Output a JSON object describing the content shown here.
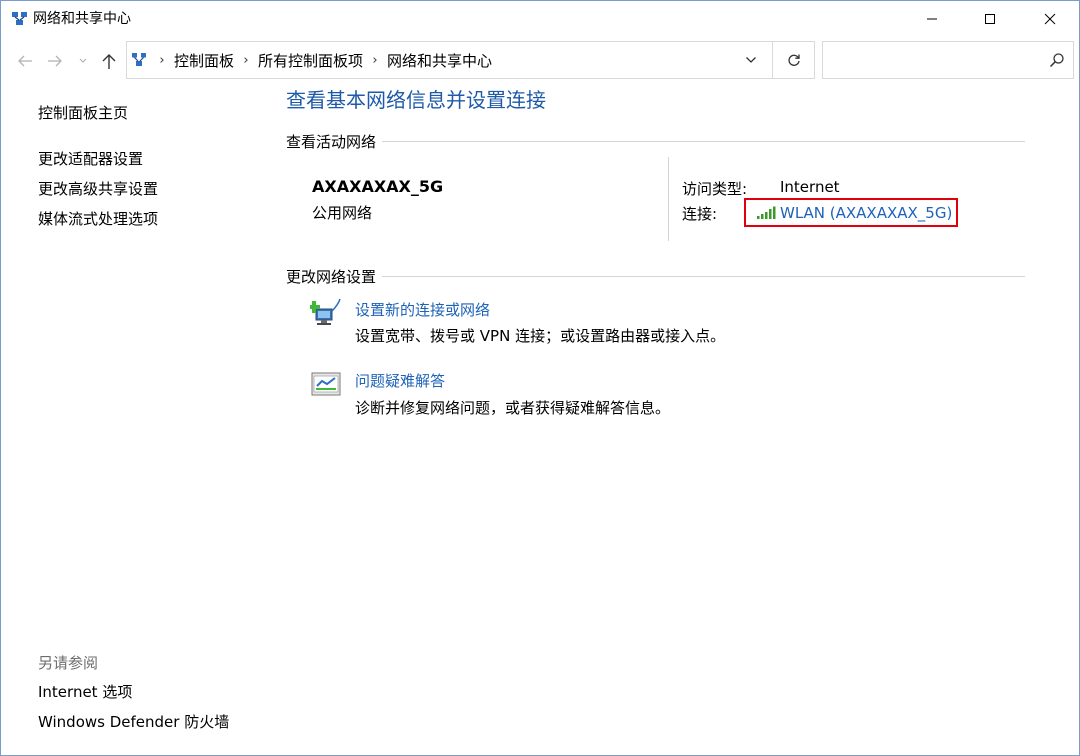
{
  "window": {
    "title": "网络和共享中心"
  },
  "address": {
    "breadcrumbs": [
      "控制面板",
      "所有控制面板项",
      "网络和共享中心"
    ],
    "search_placeholder": ""
  },
  "sidebar": {
    "home": "控制面板主页",
    "links": [
      "更改适配器设置",
      "更改高级共享设置",
      "媒体流式处理选项"
    ],
    "see_also_heading": "另请参阅",
    "see_also": [
      "Internet 选项",
      "Windows Defender 防火墙"
    ]
  },
  "main": {
    "title": "查看基本网络信息并设置连接",
    "active_networks_heading": "查看活动网络",
    "network": {
      "name": "AXAXAXAX_5G",
      "category": "公用网络",
      "access_type_label": "访问类型:",
      "access_type_value": "Internet",
      "connection_label": "连接:",
      "connection_value": "WLAN (AXAXAXAX_5G)"
    },
    "change_settings_heading": "更改网络设置",
    "tasks": [
      {
        "icon": "network-setup-icon",
        "link": "设置新的连接或网络",
        "description": "设置宽带、拨号或 VPN 连接；或设置路由器或接入点。"
      },
      {
        "icon": "troubleshoot-icon",
        "link": "问题疑难解答",
        "description": "诊断并修复网络问题，或者获得疑难解答信息。"
      }
    ]
  },
  "colors": {
    "title_blue": "#1e5aa8",
    "link_blue": "#1e63b8",
    "highlight_red": "#e0000b",
    "signal_green": "#3a9a2a"
  }
}
